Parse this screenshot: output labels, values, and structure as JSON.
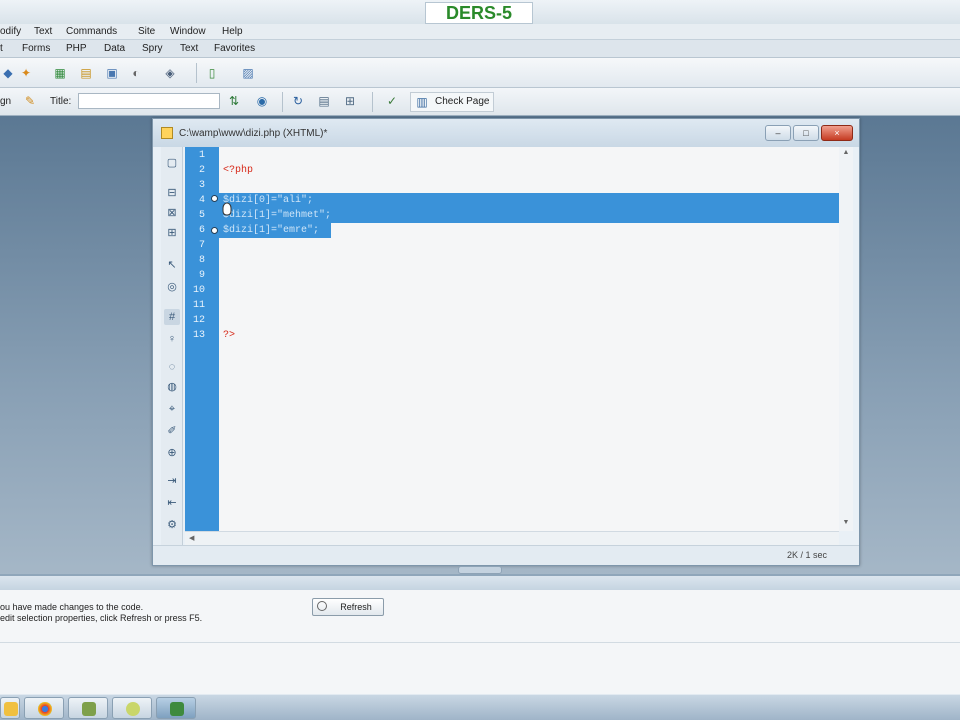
{
  "banner": {
    "label": "DERS-5"
  },
  "menubar": {
    "items": [
      "odify",
      "Text",
      "Commands",
      "Site",
      "Window",
      "Help"
    ]
  },
  "insertbar": {
    "tabs": [
      "t",
      "Forms",
      "PHP",
      "Data",
      "Spry",
      "Text",
      "Favorites"
    ]
  },
  "toolbar2": {
    "left_label": "gn",
    "title_label": "Title:",
    "title_value": "",
    "check_page_label": "Check Page"
  },
  "document": {
    "title": "C:\\wamp\\www\\dizi.php (XHTML)*",
    "lines": [
      {
        "n": "1",
        "text": ""
      },
      {
        "n": "2",
        "text": "<?php"
      },
      {
        "n": "3",
        "text": ""
      },
      {
        "n": "4",
        "text": "$dizi[0]=\"ali\";"
      },
      {
        "n": "5",
        "text": "$dizi[1]=\"mehmet\";"
      },
      {
        "n": "6",
        "text": "$dizi[1]=\"emre\";"
      },
      {
        "n": "7",
        "text": ""
      },
      {
        "n": "8",
        "text": ""
      },
      {
        "n": "9",
        "text": ""
      },
      {
        "n": "10",
        "text": ""
      },
      {
        "n": "11",
        "text": ""
      },
      {
        "n": "12",
        "text": ""
      },
      {
        "n": "13",
        "text": "?>"
      }
    ],
    "status": "2K / 1 sec"
  },
  "properties_panel": {
    "message_line1": "ou have made changes to the code.",
    "message_line2": "edit selection properties, click Refresh or press F5.",
    "refresh_label": "Refresh"
  }
}
